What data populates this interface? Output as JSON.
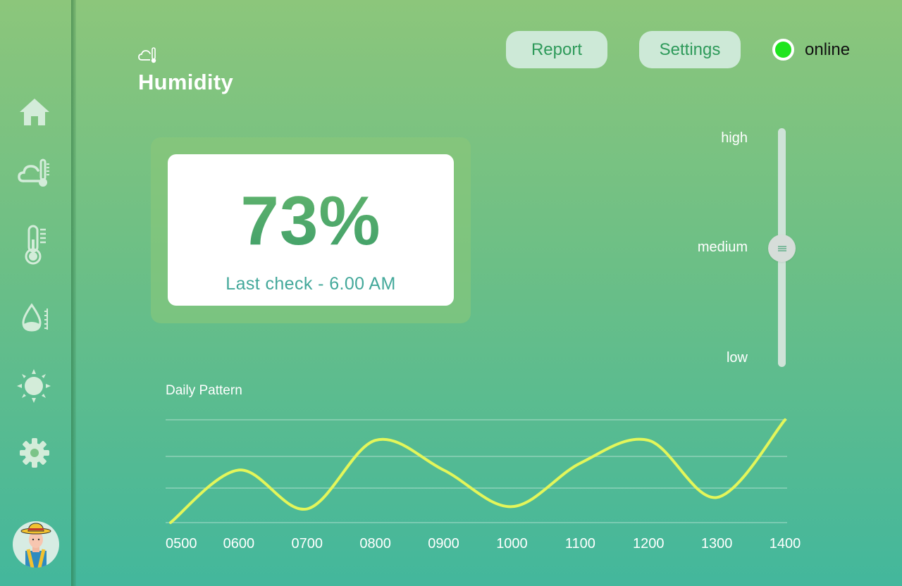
{
  "app": {
    "page_title": "Humidity"
  },
  "header": {
    "report_label": "Report",
    "settings_label": "Settings",
    "status_text": "online",
    "status_color": "#1fe51f"
  },
  "sidebar": {
    "items": [
      {
        "icon": "home-icon",
        "active": false
      },
      {
        "icon": "cloud-thermometer-icon",
        "active": true
      },
      {
        "icon": "thermometer-icon",
        "active": false
      },
      {
        "icon": "water-drop-gauge-icon",
        "active": false
      },
      {
        "icon": "sun-icon",
        "active": false
      },
      {
        "icon": "gear-icon",
        "active": false
      }
    ],
    "avatar": "farmer-avatar"
  },
  "reading": {
    "value": "73%",
    "last_check": "Last check - 6.00 AM"
  },
  "level_slider": {
    "labels": [
      "high",
      "medium",
      "low"
    ],
    "current": "medium",
    "position": 0.5
  },
  "colors": {
    "accent_line": "#e3f65a",
    "pill_bg": "#cde9d7",
    "pill_text": "#2e9a5a"
  },
  "chart_data": {
    "type": "line",
    "title": "Daily Pattern",
    "x": [
      "0500",
      "0600",
      "0700",
      "0800",
      "0900",
      "1000",
      "1100",
      "1200",
      "1300",
      "1400"
    ],
    "series": [
      {
        "values": [
          0,
          2.3,
          0.6,
          3.6,
          2.3,
          0.7,
          2.6,
          3.6,
          1.1,
          4.5
        ]
      }
    ],
    "ylim": [
      0,
      4.5
    ],
    "grid": true
  }
}
